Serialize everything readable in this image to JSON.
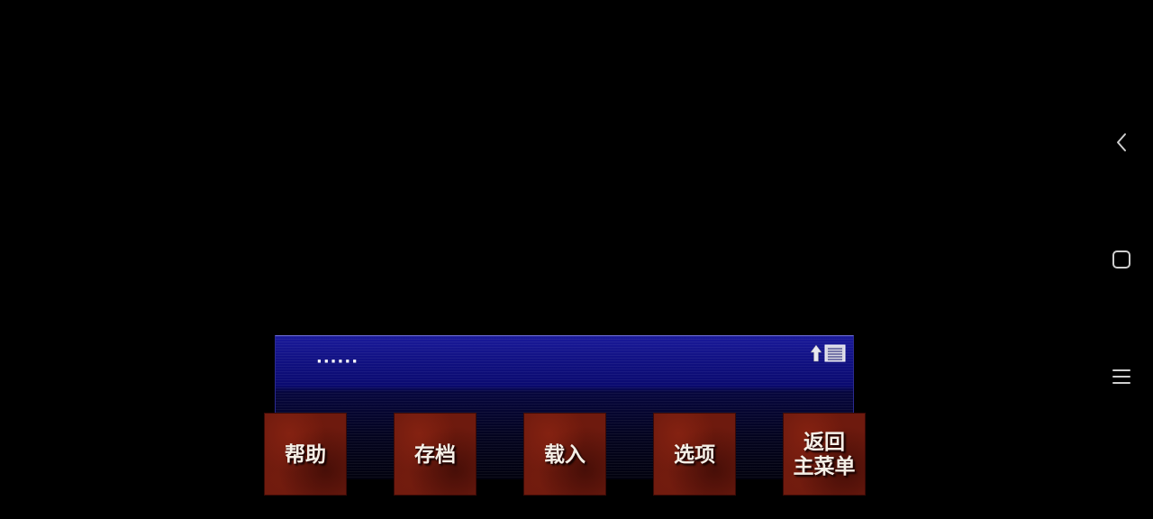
{
  "dialog": {
    "text": "······",
    "log_icon": "backlog-icon"
  },
  "menu": {
    "help": [
      "帮助"
    ],
    "save": [
      "存档"
    ],
    "load": [
      "载入"
    ],
    "options": [
      "选项"
    ],
    "return_main": [
      "返回",
      "主菜单"
    ]
  },
  "system_nav": {
    "back_icon": "back-chevron-icon",
    "home_icon": "home-square-icon",
    "recents_icon": "menu-lines-icon"
  },
  "colors": {
    "dialog_blue": "#101080",
    "button_red": "#6e1a0e",
    "text": "#ffffff"
  }
}
